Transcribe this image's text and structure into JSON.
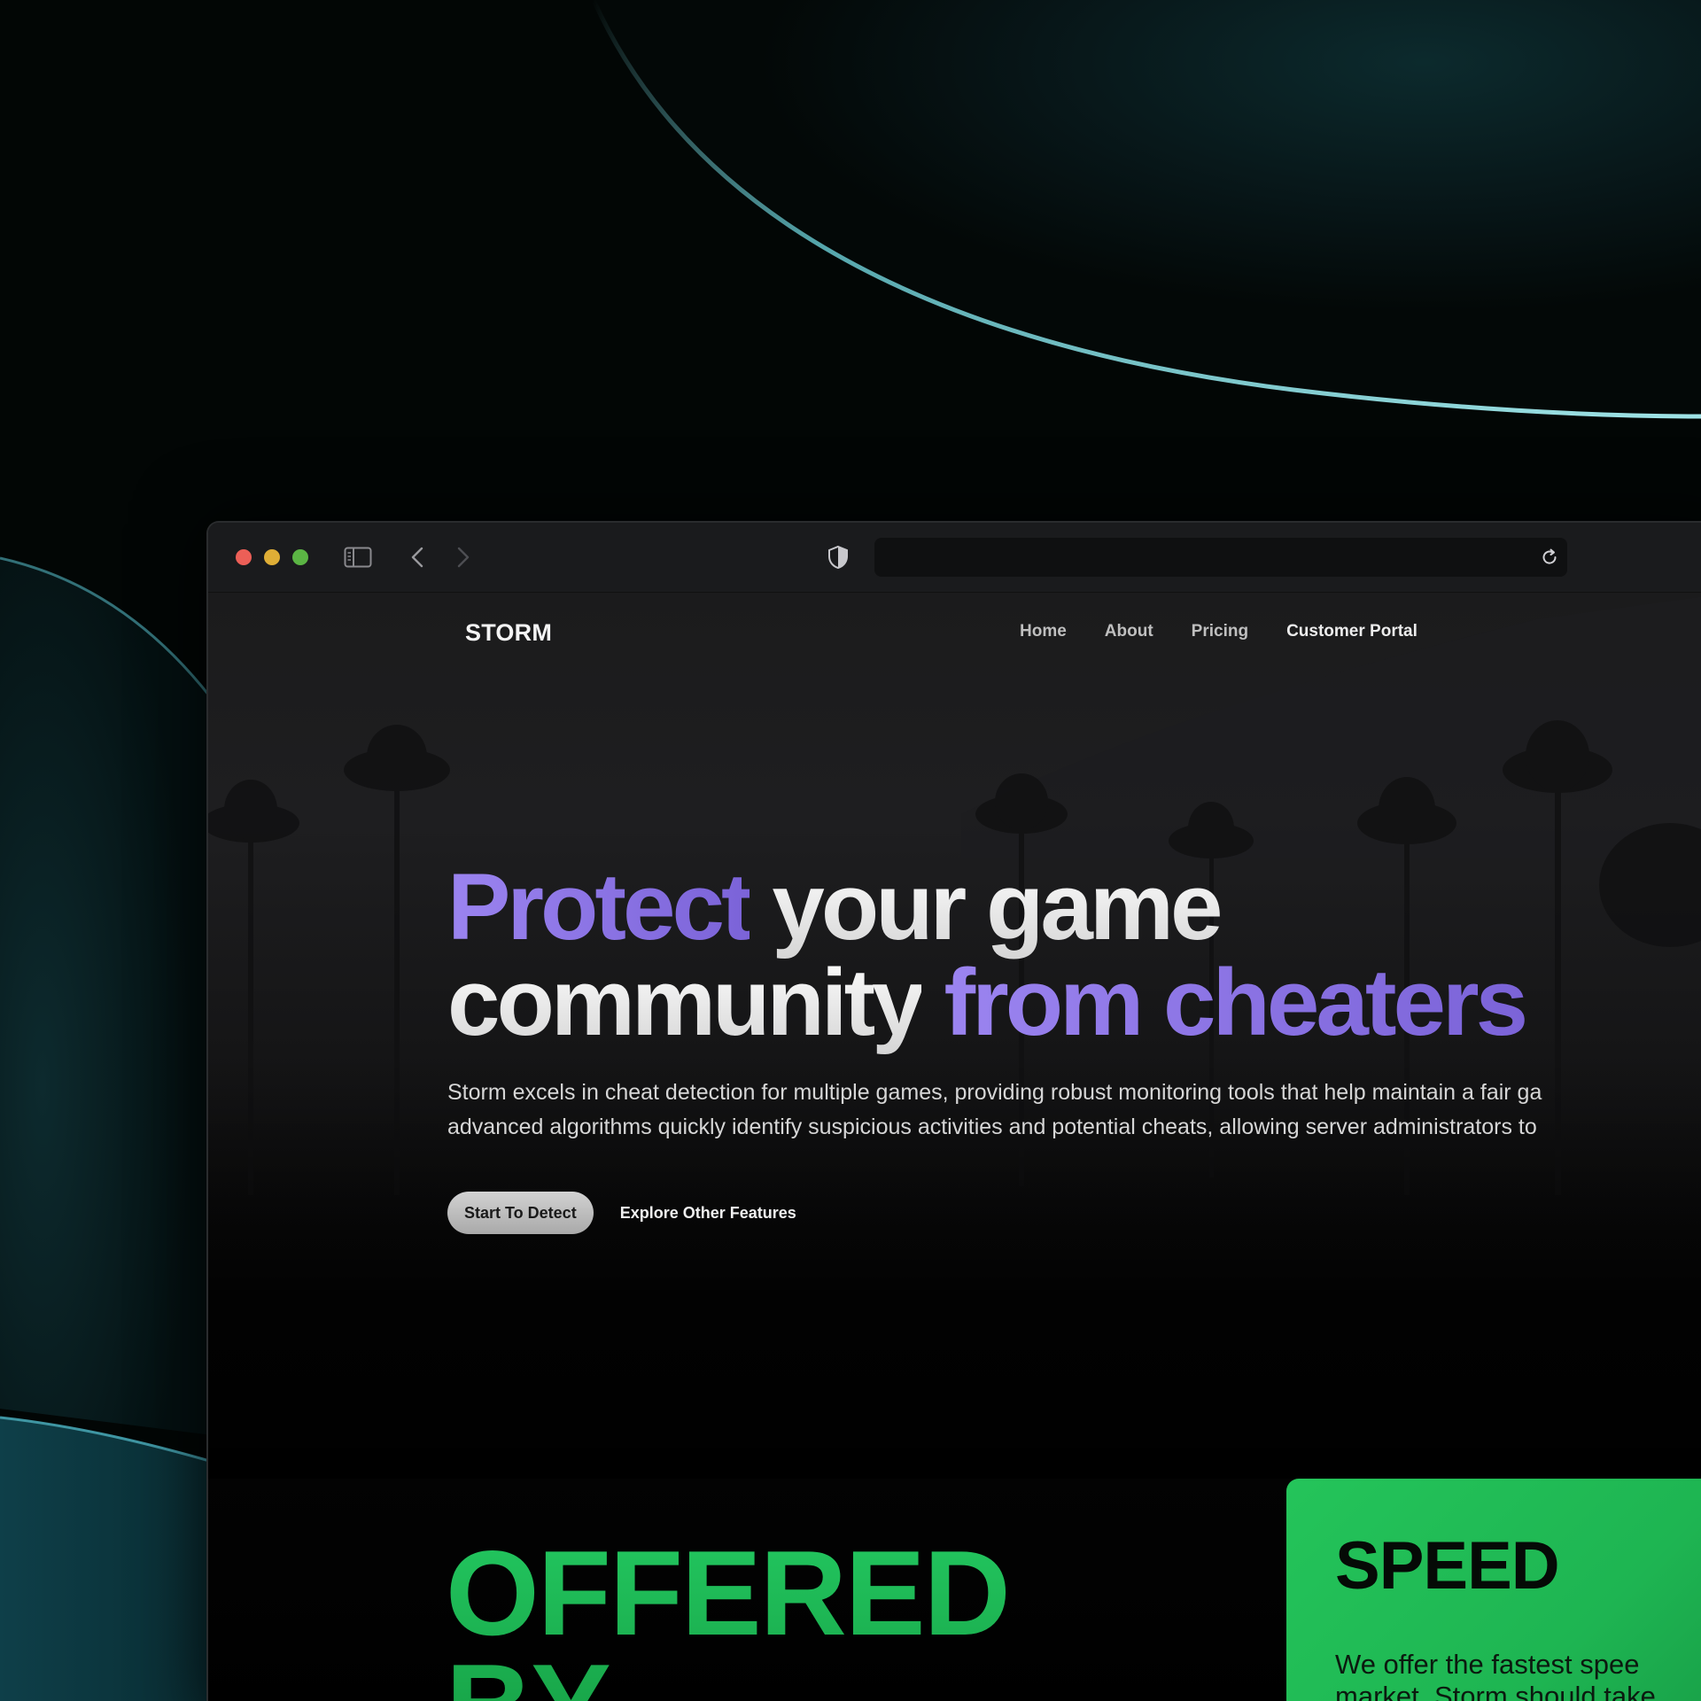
{
  "browser": {
    "url": ""
  },
  "site": {
    "brand": "STORM",
    "nav": {
      "home": "Home",
      "about": "About",
      "pricing": "Pricing",
      "portal": "Customer Portal"
    }
  },
  "hero": {
    "headline": {
      "w1": "Protect",
      "w2": "your game",
      "w3": "community",
      "w4": "from cheaters"
    },
    "subtext_line1": "Storm excels in cheat detection for multiple games, providing robust monitoring tools that help maintain a fair ga",
    "subtext_line2": "advanced algorithms quickly identify suspicious activities and potential cheats, allowing server administrators to",
    "cta_primary": "Start To Detect",
    "cta_secondary": "Explore Other Features"
  },
  "features": {
    "offered_line1": "OFFERED",
    "offered_line2": "BY",
    "card": {
      "title": "SPEED",
      "text_line1": "We offer the fastest spee",
      "text_line2": "market. Storm should take"
    }
  },
  "colors": {
    "accent_purple": "#8f78ea",
    "accent_green": "#22c55e",
    "window_bg": "#1a1b1d"
  },
  "icons": {
    "sidebar": "sidebar-icon",
    "back": "chevron-left-icon",
    "forward": "chevron-right-icon",
    "privacy": "shield-icon",
    "reload": "reload-icon"
  }
}
